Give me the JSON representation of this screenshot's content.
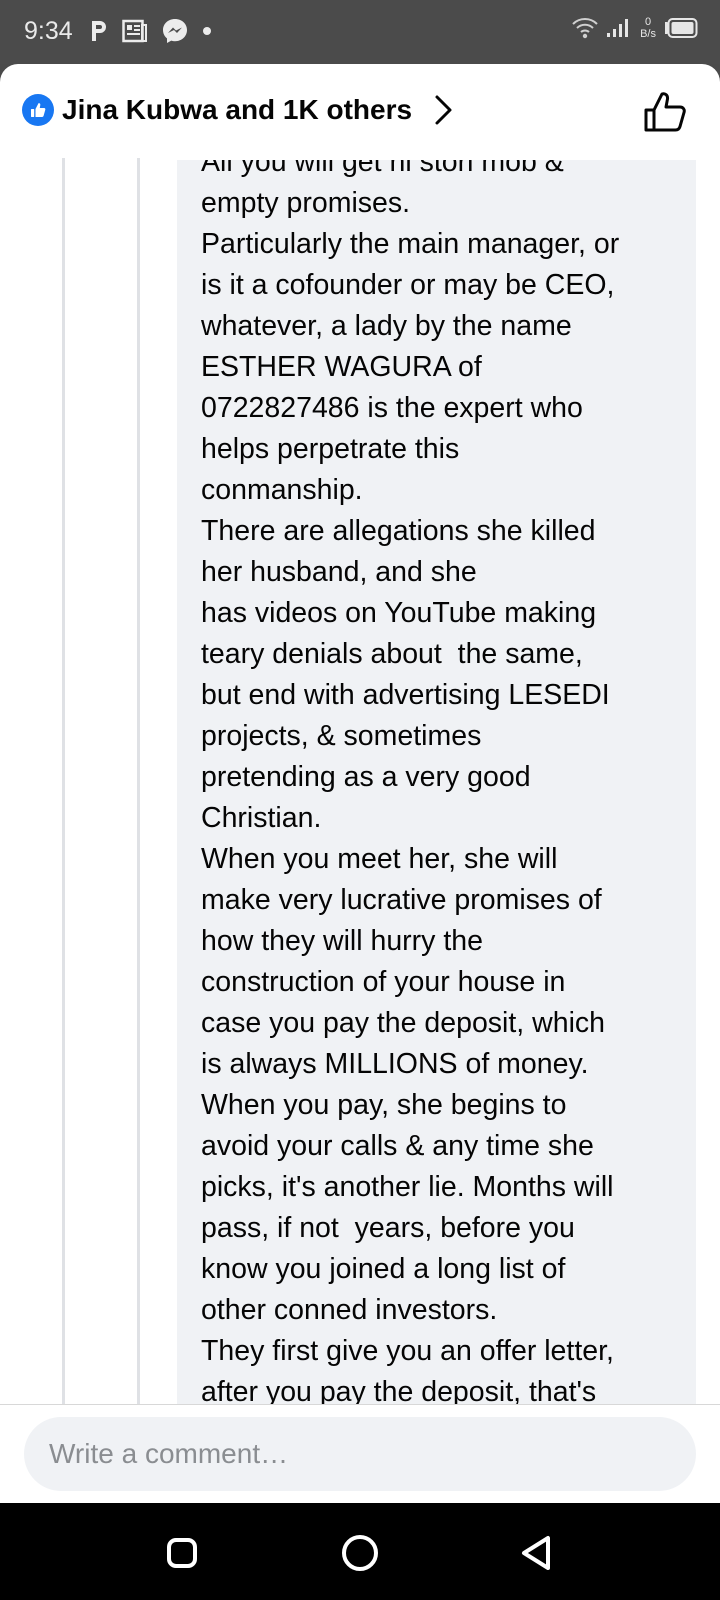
{
  "status_bar": {
    "time": "9:34",
    "left_icons": [
      "p-notification-icon",
      "news-icon",
      "messenger-icon",
      "dot-icon"
    ],
    "net_speed_value": "0",
    "net_speed_unit": "B/s"
  },
  "reactions": {
    "summary": "Jina Kubwa and 1K others"
  },
  "comment": {
    "lines": [
      "All you will get ni stori mob &",
      "empty promises.",
      "Particularly the main manager, or",
      "is it a cofounder or may be CEO,",
      "whatever, a lady by the name",
      "ESTHER WAGURA of",
      "0722827486 is the expert who",
      "helps perpetrate this",
      "conmanship.",
      "There are allegations she killed",
      "her husband, and she",
      "has videos on YouTube making",
      "teary denials about  the same,",
      "but end with advertising LESEDI",
      "projects, & sometimes",
      "pretending as a very good",
      "Christian.",
      "When you meet her, she will",
      "make very lucrative promises of",
      "how they will hurry the",
      "construction of your house in",
      "case you pay the deposit, which",
      "is always MILLIONS of money.",
      "When you pay, she begins to",
      "avoid your calls & any time she",
      "picks, it's another lie. Months will",
      "pass, if not  years, before you",
      "know you joined a long list of",
      "other conned investors.",
      "They first give you an offer letter,",
      "after you pay the deposit, that's"
    ]
  },
  "composer": {
    "placeholder": "Write a comment…"
  },
  "nav": {
    "buttons": [
      "recents-square-icon",
      "home-circle-icon",
      "back-triangle-icon"
    ]
  },
  "colors": {
    "facebook_blue": "#1877f2",
    "bubble_bg": "#f0f2f5",
    "status_bar_bg": "#4b4b4b",
    "nav_bar_bg": "#000000"
  }
}
